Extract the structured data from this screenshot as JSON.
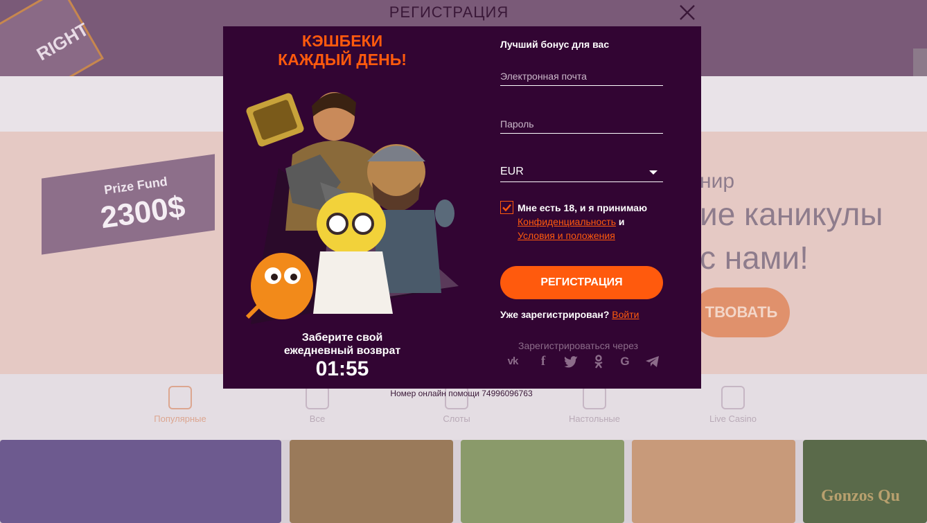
{
  "modal": {
    "title": "РЕГИСТРАЦИЯ",
    "promo": {
      "headline_line1": "КЭШБЕКИ",
      "headline_line2": "КАЖДЫЙ ДЕНЬ!",
      "timer_caption_line1": "Заберите свой",
      "timer_caption_line2": "ежедневный возврат",
      "timer_value": "01:55"
    },
    "form": {
      "bonus_label": "Лучший бонус для вас",
      "email_placeholder": "Электронная почта",
      "password_placeholder": "Пароль",
      "currency_value": "EUR",
      "agree_checked": true,
      "agree_text": "Мне есть 18, и я принимаю",
      "privacy_link": "Конфиденциальность",
      "and_text": "и",
      "terms_link": "Условия и положения",
      "register_label": "РЕГИСТРАЦИЯ",
      "already_registered": "Уже зарегистрирован?",
      "login_link": "Войти",
      "social_label": "Зарегистрироваться через",
      "social_icons": [
        "vk-icon",
        "facebook-icon",
        "twitter-icon",
        "odnoklassniki-icon",
        "google-icon",
        "telegram-icon"
      ]
    },
    "helpline": "Номер онлайн помощи 74996096763"
  },
  "background": {
    "logo_text": "RIGHT",
    "prize_small": "Prize Fund",
    "prize_big": "2300$",
    "promo_sub": "нир",
    "promo_line1": "ие каникулы",
    "promo_line2": "с нами!",
    "promo_button": "ТВОВАТЬ",
    "categories": [
      "Популярные",
      "Все",
      "Слоты",
      "Настольные",
      "Live Casino"
    ],
    "game_title": "Gonzos Qu"
  },
  "colors": {
    "modal_bg": "#320533",
    "accent": "#ff5a0d",
    "text": "#ffffff",
    "muted": "#8c6c8a"
  }
}
